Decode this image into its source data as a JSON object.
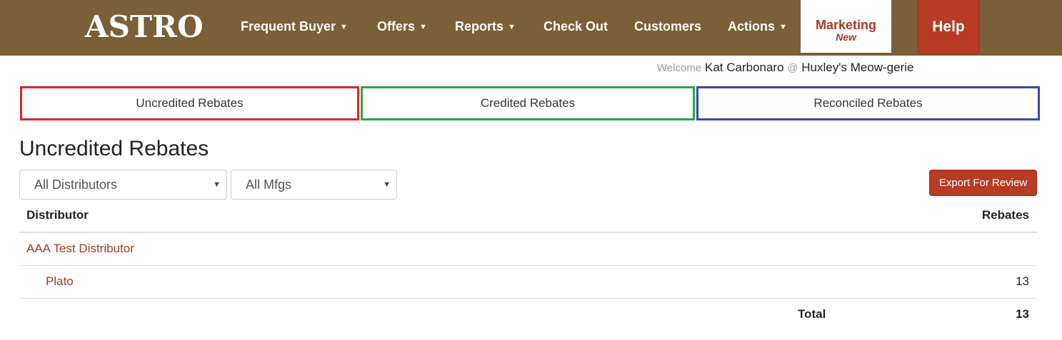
{
  "brand": {
    "logo_text": "ASTRO",
    "nav_bg": "#7a5f37",
    "accent": "#b73b25",
    "link_color": "#a33a26"
  },
  "nav": {
    "frequent_buyer": "Frequent Buyer",
    "offers": "Offers",
    "reports": "Reports",
    "check_out": "Check Out",
    "customers": "Customers",
    "actions": "Actions",
    "marketing": "Marketing",
    "marketing_badge": "New",
    "help": "Help"
  },
  "welcome": {
    "prefix": "Welcome",
    "user": "Kat Carbonaro",
    "at": "@",
    "store": "Huxley's Meow-gerie"
  },
  "tabs": [
    {
      "label": "Uncredited Rebates",
      "border_color": "#e0232a"
    },
    {
      "label": "Credited Rebates",
      "border_color": "#22a64a"
    },
    {
      "label": "Reconciled Rebates",
      "border_color": "#3a45b6"
    }
  ],
  "page": {
    "title": "Uncredited Rebates"
  },
  "filters": {
    "distributor_selected": "All Distributors",
    "mfg_selected": "All Mfgs",
    "export_label": "Export For Review"
  },
  "table": {
    "columns": [
      "Distributor",
      "Rebates"
    ],
    "rows": [
      {
        "name": "AAA Test Distributor",
        "rebates": ""
      },
      {
        "name": "Plato",
        "rebates": "13"
      }
    ],
    "total_label": "Total",
    "total_value": "13"
  }
}
